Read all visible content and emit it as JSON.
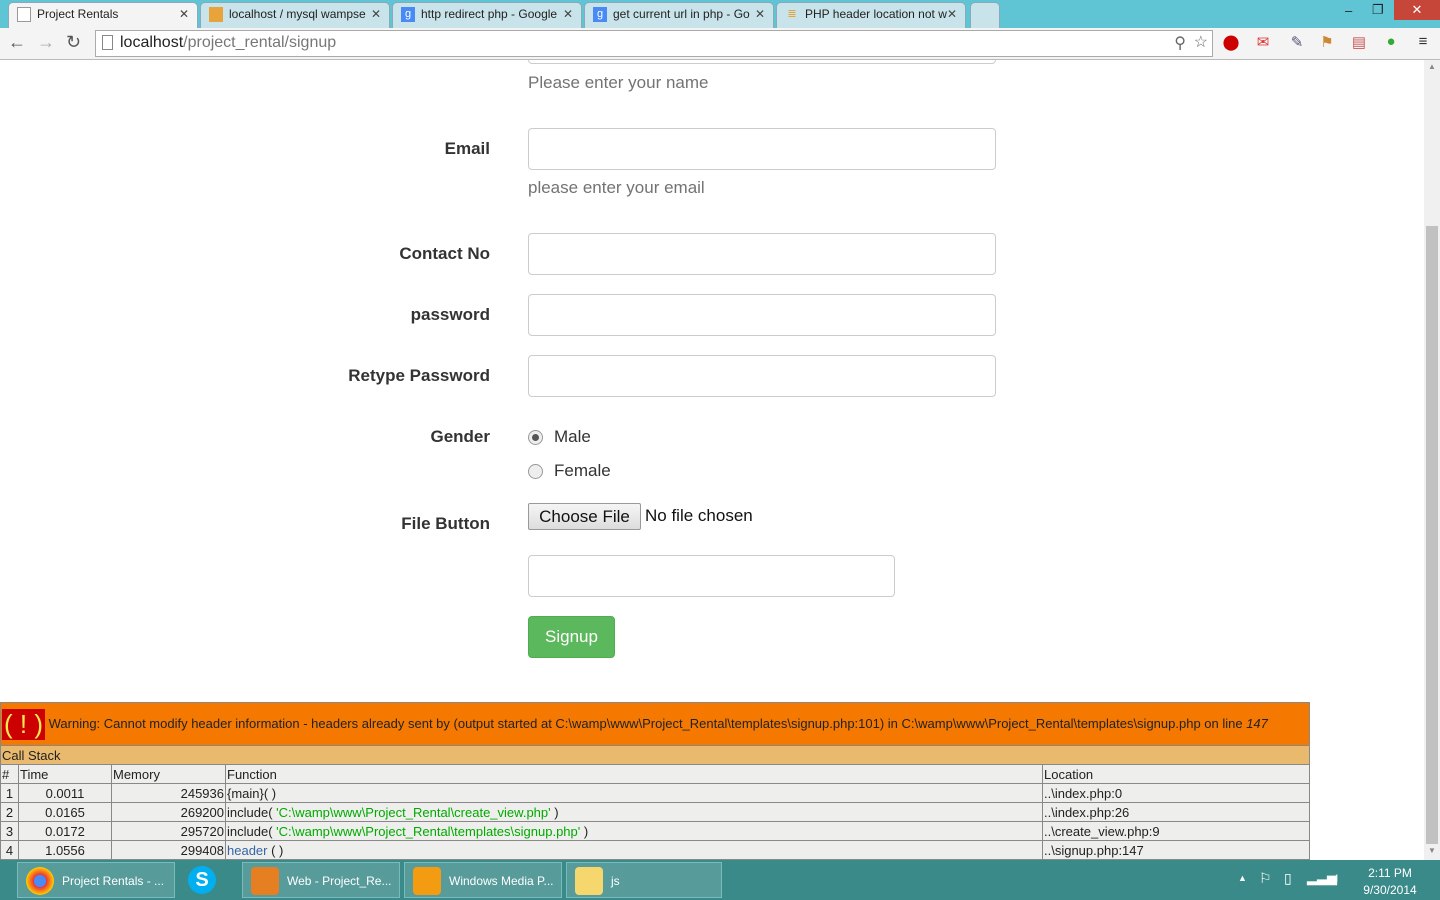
{
  "browser": {
    "tabs": [
      {
        "title": "Project Rentals",
        "icon": "page-icon"
      },
      {
        "title": "localhost / mysql wampse",
        "icon": "phpmyadmin-icon"
      },
      {
        "title": "http redirect php - Google",
        "icon": "google-icon"
      },
      {
        "title": "get current url in php - Go",
        "icon": "google-icon"
      },
      {
        "title": "PHP header location not w",
        "icon": "stackoverflow-icon"
      }
    ],
    "url_host": "localhost",
    "url_path": "/project_rental/signup"
  },
  "form": {
    "name_help": "Please enter your name",
    "email_label": "Email",
    "email_help": "please enter your email",
    "contact_label": "Contact No",
    "password_label": "password",
    "retype_label": "Retype Password",
    "gender_label": "Gender",
    "gender_options": [
      "Male",
      "Female"
    ],
    "gender_selected": "Male",
    "file_label": "File Button",
    "file_button": "Choose File",
    "file_status": "No file chosen",
    "signup_button": "Signup",
    "signup_color": "#5cb85c"
  },
  "warning": {
    "icon": "( ! )",
    "message": "Warning: Cannot modify header information - headers already sent by (output started at C:\\wamp\\www\\Project_Rental\\templates\\signup.php:101) in C:\\wamp\\www\\Project_Rental\\templates\\signup.php on line ",
    "line": "147",
    "call_stack_title": "Call Stack",
    "headers": [
      "#",
      "Time",
      "Memory",
      "Function",
      "Location"
    ],
    "rows": [
      {
        "n": "1",
        "time": "0.0011",
        "memory": "245936",
        "fn": "{main}( )",
        "arg": "",
        "loc": "..\\index.php:0"
      },
      {
        "n": "2",
        "time": "0.0165",
        "memory": "269200",
        "fn": "include( ",
        "arg": "'C:\\wamp\\www\\Project_Rental\\create_view.php'",
        "end": " )",
        "loc": "..\\index.php:26"
      },
      {
        "n": "3",
        "time": "0.0172",
        "memory": "295720",
        "fn": "include( ",
        "arg": "'C:\\wamp\\www\\Project_Rental\\templates\\signup.php'",
        "end": " )",
        "loc": "..\\create_view.php:9"
      },
      {
        "n": "4",
        "time": "1.0556",
        "memory": "299408",
        "fnlink": "header",
        "end": " ( )",
        "loc": "..\\signup.php:147"
      }
    ]
  },
  "taskbar": {
    "items": [
      "Project Rentals - ...",
      "",
      "Web - Project_Re...",
      "Windows Media P...",
      "js"
    ],
    "time": "2:11 PM",
    "date": "9/30/2014"
  }
}
